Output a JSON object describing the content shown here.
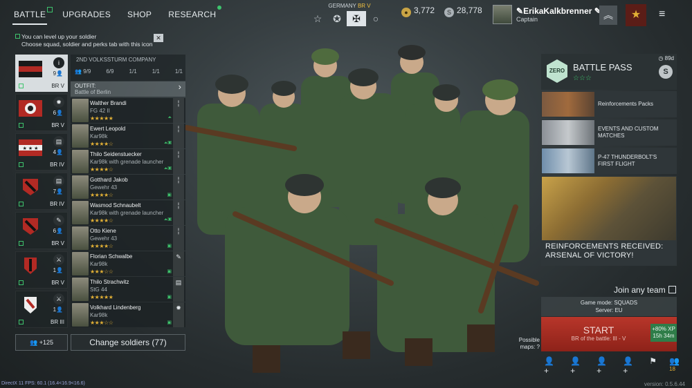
{
  "nav": {
    "tabs": [
      "BATTLE",
      "UPGRADES",
      "SHOP",
      "RESEARCH"
    ]
  },
  "nation": {
    "label": "GERMANY",
    "br": "BR V"
  },
  "currency": {
    "gold": "3,772",
    "silver": "28,778"
  },
  "profile": {
    "name": "ErikaKalkbrenner",
    "rank": "Captain"
  },
  "notice": {
    "line1": "You can level up your soldier",
    "line2": "Choose squad, soldier and perks tab with this icon"
  },
  "squads": [
    {
      "count": "9",
      "br": "BR V"
    },
    {
      "count": "6",
      "br": "BR V"
    },
    {
      "count": "4",
      "br": "BR IV"
    },
    {
      "count": "7",
      "br": "BR IV"
    },
    {
      "count": "6",
      "br": "BR V"
    },
    {
      "count": "1",
      "br": "BR V"
    },
    {
      "count": "1",
      "br": "BR III"
    }
  ],
  "company": {
    "name": "2ND VOLKSSTURM COMPANY",
    "s1": "9/9",
    "s2": "6/9",
    "s3": "1/1",
    "s4": "1/1",
    "s5": "1/1"
  },
  "outfit": {
    "label": "OUTFIT:",
    "value": "Battle of Berlin"
  },
  "soldiers": [
    {
      "name": "Walther Brandi",
      "weapon": "FG 42 II",
      "stars": "★★★★★"
    },
    {
      "name": "Ewert Leopold",
      "weapon": "Kar98k",
      "stars": "★★★★☆"
    },
    {
      "name": "Thilo Seidenstuecker",
      "weapon": "Kar98k with grenade launcher",
      "stars": "★★★★☆"
    },
    {
      "name": "Gotthard Jakob",
      "weapon": "Gewehr 43",
      "stars": "★★★★☆"
    },
    {
      "name": "Wasmod Schnaubelt",
      "weapon": "Kar98k with grenade launcher",
      "stars": "★★★★☆"
    },
    {
      "name": "Otto Kiene",
      "weapon": "Gewehr 43",
      "stars": "★★★★☆"
    },
    {
      "name": "Florian Schwalbe",
      "weapon": "Kar98k",
      "stars": "★★★☆☆"
    },
    {
      "name": "Thilo Strachwitz",
      "weapon": "StG 44",
      "stars": "★★★★★"
    },
    {
      "name": "Volkhard Lindenberg",
      "weapon": "Kar98k",
      "stars": "★★★☆☆"
    }
  ],
  "invite": {
    "count": "+125"
  },
  "change_soldiers": "Change soldiers (77)",
  "battlepass": {
    "title": "BATTLE PASS",
    "days": "89d",
    "logo": "ZERO"
  },
  "promos": [
    "Reinforcements Packs",
    "EVENTS AND CUSTOM MATCHES",
    "P-47 THUNDERBOLT'S FIRST FLIGHT"
  ],
  "bigpromo": {
    "line1": "REINFORCEMENTS RECEIVED:",
    "line2": "ARSENAL OF VICTORY!"
  },
  "join": "Join any team",
  "mode": {
    "line1": "Game mode: SQUADS",
    "line2": "Server: EU"
  },
  "start": {
    "label": "START",
    "br": "BR of the battle: III - V",
    "xp": "+80% XP",
    "time": "15h 34m"
  },
  "maps": {
    "line1": "Possible",
    "line2": "maps:"
  },
  "friends_count": "18",
  "fps": "DirectX 11 FPS: 60.1 (16.4<16.9<16.6)",
  "version": "version: 0.5.6.44"
}
